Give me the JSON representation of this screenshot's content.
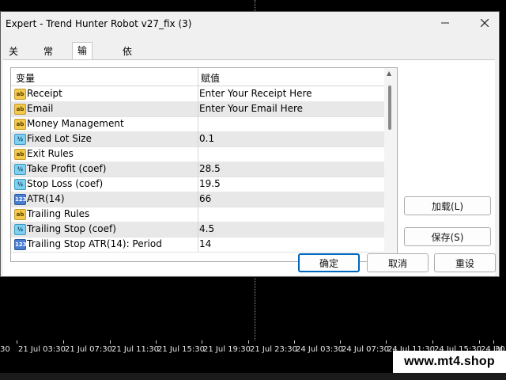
{
  "chart": {
    "time_labels": [
      "30",
      "21 Jul 03:30",
      "21 Jul 07:30",
      "21 Jul 11:30",
      "21 Jul 15:30",
      "21 Jul 19:30",
      "21 Jul 23:30",
      "24 Jul 03:30",
      "24 Jul 07:30",
      "24 Jul 11:30",
      "24 Jul 15:30",
      "24 Jul 19:30",
      "30"
    ],
    "watermark": "www.mt4.shop"
  },
  "dialog": {
    "title": "Expert - Trend Hunter Robot v27_fix (3)",
    "minimize_icon": "minimize-icon",
    "close_icon": "close-icon",
    "tabs": [
      {
        "label": "关于"
      },
      {
        "label": "常用"
      },
      {
        "label": "输入参数",
        "active": true
      },
      {
        "label": "依存关系"
      }
    ],
    "table": {
      "headers": {
        "variable": "变量",
        "value": "赋值"
      },
      "rows": [
        {
          "type": "string",
          "type_icon": "ab",
          "name": "Receipt",
          "value": "Enter Your Receipt Here"
        },
        {
          "type": "string",
          "type_icon": "ab",
          "name": "Email",
          "value": "Enter Your Email Here"
        },
        {
          "type": "string",
          "type_icon": "ab",
          "name": "Money Management",
          "value": ""
        },
        {
          "type": "double",
          "type_icon": "½",
          "name": "Fixed Lot Size",
          "value": "0.1"
        },
        {
          "type": "string",
          "type_icon": "ab",
          "name": "Exit Rules",
          "value": ""
        },
        {
          "type": "double",
          "type_icon": "½",
          "name": "Take Profit (coef)",
          "value": "28.5"
        },
        {
          "type": "double",
          "type_icon": "½",
          "name": "Stop Loss (coef)",
          "value": "19.5"
        },
        {
          "type": "int",
          "type_icon": "123",
          "name": "ATR(14)",
          "value": "66"
        },
        {
          "type": "string",
          "type_icon": "ab",
          "name": "Trailing Rules",
          "value": ""
        },
        {
          "type": "double",
          "type_icon": "½",
          "name": "Trailing Stop (coef)",
          "value": "4.5"
        },
        {
          "type": "int",
          "type_icon": "123",
          "name": "Trailing Stop ATR(14): Period",
          "value": "14"
        }
      ]
    },
    "buttons": {
      "load": "加载(L)",
      "save": "保存(S)",
      "ok": "确定",
      "cancel": "取消",
      "reset": "重设"
    }
  }
}
